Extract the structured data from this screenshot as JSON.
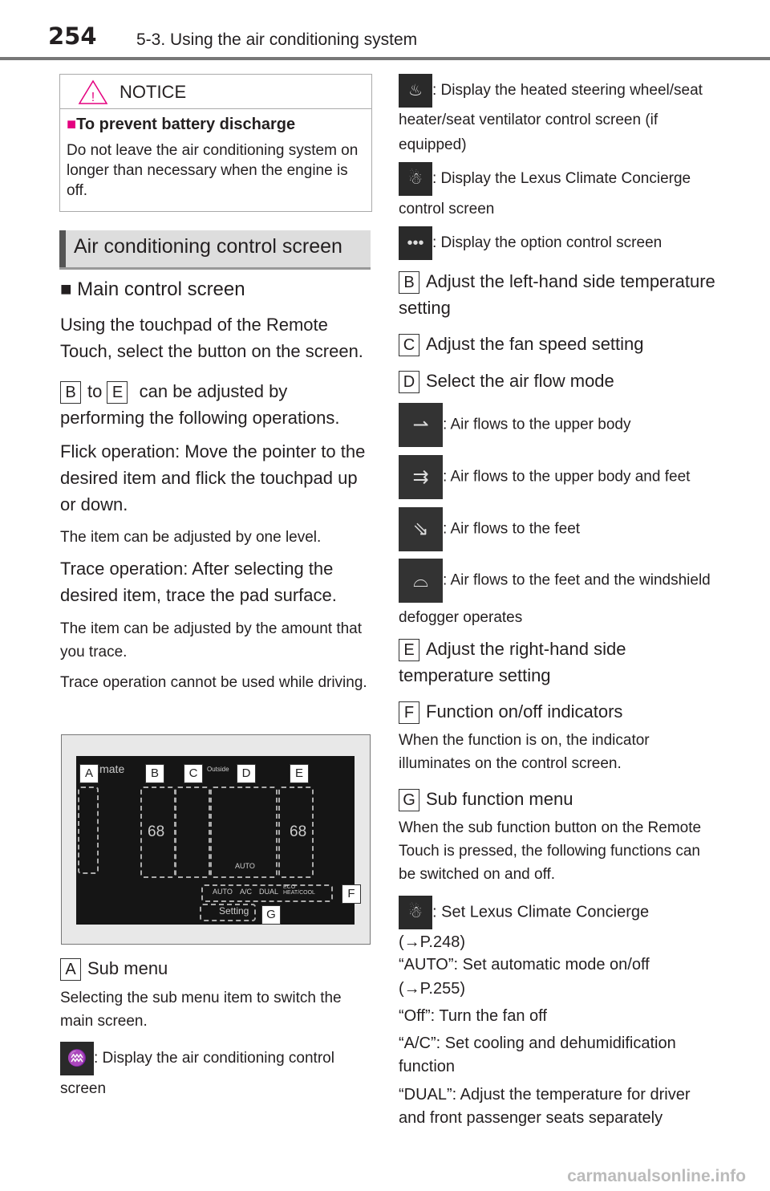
{
  "header": {
    "page_number": "254",
    "section": "5-3. Using the air conditioning system"
  },
  "notice": {
    "title": "NOTICE",
    "subtitle": "To prevent battery discharge",
    "text": "Do not leave the air conditioning system on longer than necessary when the engine is off."
  },
  "section_title": "Air conditioning control screen",
  "left": {
    "subhead": "Main control screen",
    "p1": "Using the touchpad of the Remote Touch, select the button on the screen.",
    "p2_from": "B",
    "p2_to_word": "to",
    "p2_to": "E",
    "p2_text": "can be adjusted by performing the following operations.",
    "p3": "Flick operation: Move the pointer to the desired item and flick the touchpad up or down.",
    "p4": "The item can be adjusted by one level.",
    "p5": "Trace operation: After selecting the desired item, trace the pad surface.",
    "p6": "The item can be adjusted by the amount that you trace.",
    "p7": "Trace operation cannot be used while driving.",
    "screen": {
      "title": "imate",
      "outside": "Outside",
      "temp_left": "68",
      "temp_right": "68",
      "mode": "AUTO",
      "buttons": [
        "AUTO",
        "A/C",
        "DUAL",
        "ECO HEAT/COOL"
      ],
      "setting": "Setting",
      "labels": [
        "A",
        "B",
        "C",
        "D",
        "E",
        "F",
        "G"
      ]
    },
    "a_label": "A",
    "a_title": "Sub menu",
    "a_text": "Selecting the sub menu item to switch the main screen.",
    "a_icon_text": ": Display the air conditioning control screen"
  },
  "right": {
    "i1": ": Display the heated steering wheel/seat heater/seat ventilator control screen (if equipped)",
    "i2": ": Display the Lexus Climate Concierge control screen",
    "i3": ": Display the option control screen",
    "b_label": "B",
    "b_text": "Adjust the left-hand side temperature setting",
    "c_label": "C",
    "c_text": "Adjust the fan speed setting",
    "d_label": "D",
    "d_text": "Select the air flow mode",
    "f1": ": Air flows to the upper body",
    "f2": ": Air flows to the upper body and feet",
    "f3": ": Air flows to the feet",
    "f4": ": Air flows to the feet and the windshield defogger operates",
    "e_label": "E",
    "e_text": "Adjust the right-hand side temperature setting",
    "f_label": "F",
    "f_text": "Function on/off indicators",
    "f_desc": "When the function is on, the indicator illuminates on the control screen.",
    "g_label": "G",
    "g_text": "Sub function menu",
    "g_desc": "When the sub function button on the Remote Touch is pressed, the following functions can be switched on and off.",
    "g1": ": Set Lexus Climate Concierge (→P.248)",
    "g2": "“AUTO”: Set automatic mode on/off (→P.255)",
    "g3": "“Off”: Turn the fan off",
    "g4": "“A/C”: Set cooling and dehumidification function",
    "g5": "“DUAL”: Adjust the temperature for driver and front passenger seats separately"
  },
  "footer": "carmanualsonline.info"
}
